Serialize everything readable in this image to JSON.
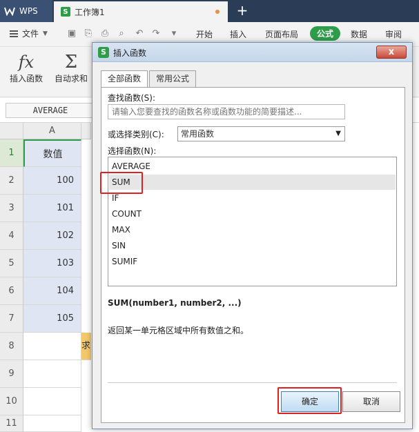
{
  "titlebar": {
    "app_tab": "WPS",
    "doc_tab": "工作簿1",
    "new_tab": "+"
  },
  "menubar": {
    "file": "文件",
    "tabs": [
      "开始",
      "插入",
      "页面布局",
      "公式",
      "数据",
      "审阅"
    ],
    "active_tab": "公式"
  },
  "ribbon": {
    "insert_function": "插入函数",
    "autosum": "自动求和"
  },
  "formulabar": {
    "name_box": "AVERAGE"
  },
  "grid": {
    "column_a": "A",
    "rows": [
      "1",
      "2",
      "3",
      "4",
      "5",
      "6",
      "7",
      "8",
      "9",
      "10",
      "11"
    ],
    "active_row": "1",
    "header_cell": "数值",
    "values": [
      "100",
      "101",
      "102",
      "103",
      "104",
      "105"
    ],
    "b8_partial": "求"
  },
  "dialog": {
    "title": "插入函数",
    "close": "x",
    "tabs": [
      "全部函数",
      "常用公式"
    ],
    "search_label": "查找函数(S):",
    "search_placeholder": "请输入您要查找的函数名称或函数功能的简要描述...",
    "category_label": "或选择类别(C):",
    "category_value": "常用函数",
    "select_label": "选择函数(N):",
    "functions": [
      "AVERAGE",
      "SUM",
      "IF",
      "COUNT",
      "MAX",
      "SIN",
      "SUMIF"
    ],
    "selected_function": "SUM",
    "signature": "SUM(number1, number2, ...)",
    "description": "返回某一单元格区域中所有数值之和。",
    "ok": "确定",
    "cancel": "取消"
  },
  "colors": {
    "accent": "#2e9d4a",
    "titlebar": "#2b3d56",
    "highlight": "#e02020",
    "selected_cells": "#dfe5f3"
  }
}
